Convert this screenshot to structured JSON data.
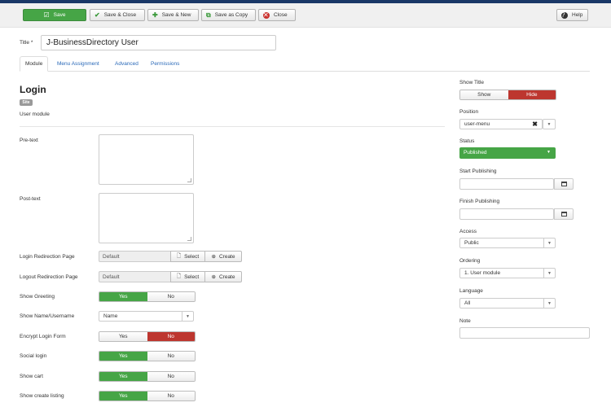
{
  "toolbar": {
    "save": "Save",
    "save_close": "Save & Close",
    "save_new": "Save & New",
    "save_copy": "Save as Copy",
    "close": "Close",
    "help": "Help"
  },
  "title": {
    "label": "Title *",
    "value": "J-BusinessDirectory User"
  },
  "tabs": [
    "Module",
    "Menu Assignment",
    "Advanced",
    "Permissions"
  ],
  "module": {
    "heading": "Login",
    "badge": "Site",
    "description": "User module"
  },
  "fields": {
    "pretext": "Pre-text",
    "posttext": "Post-text",
    "login_redirect": {
      "label": "Login Redirection Page",
      "value": "Default",
      "select": "Select",
      "create": "Create"
    },
    "logout_redirect": {
      "label": "Logout Redirection Page",
      "value": "Default",
      "select": "Select",
      "create": "Create"
    },
    "show_greeting": {
      "label": "Show Greeting",
      "yes": "Yes",
      "no": "No"
    },
    "show_name": {
      "label": "Show Name/Username",
      "value": "Name"
    },
    "encrypt": {
      "label": "Encrypt Login Form",
      "yes": "Yes",
      "no": "No"
    },
    "social": {
      "label": "Social login",
      "yes": "Yes",
      "no": "No"
    },
    "cart": {
      "label": "Show cart",
      "yes": "Yes",
      "no": "No"
    },
    "create_listing": {
      "label": "Show create listing",
      "yes": "Yes",
      "no": "No"
    }
  },
  "sidebar": {
    "show_title": {
      "label": "Show Title",
      "show": "Show",
      "hide": "Hide"
    },
    "position": {
      "label": "Position",
      "value": "user-menu"
    },
    "status": {
      "label": "Status",
      "value": "Published"
    },
    "start_publishing": "Start Publishing",
    "finish_publishing": "Finish Publishing",
    "access": {
      "label": "Access",
      "value": "Public"
    },
    "ordering": {
      "label": "Ordering",
      "value": "1. User module"
    },
    "language": {
      "label": "Language",
      "value": "All"
    },
    "note": "Note"
  }
}
